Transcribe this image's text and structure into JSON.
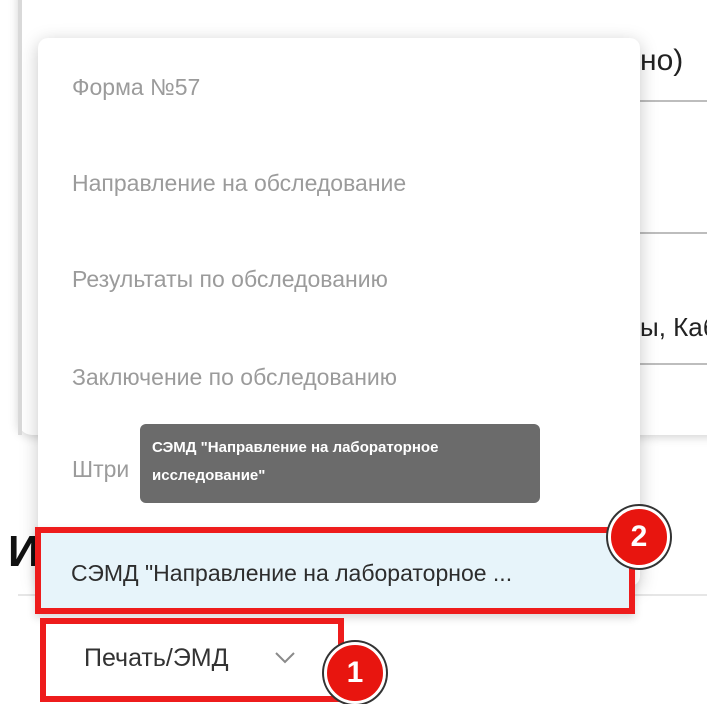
{
  "background": {
    "field1_text": "но)",
    "field3_text": "ы, Каб",
    "section_title": "И"
  },
  "dropdown": {
    "items": [
      "Форма №57",
      "Направление на обследование",
      "Результаты по обследованию",
      "Заключение по обследованию",
      "Штри"
    ],
    "selected_item": "СЭМД \"Направление на лабораторное ...",
    "tooltip": "СЭМД \"Направление на лабораторное исследование\""
  },
  "print_button": {
    "label": "Печать/ЭМД"
  },
  "badges": {
    "one": "1",
    "two": "2"
  },
  "colors": {
    "highlight": "#ee1c1c",
    "selected_bg": "#e7f4fa",
    "tooltip_bg": "#6b6b6b"
  }
}
